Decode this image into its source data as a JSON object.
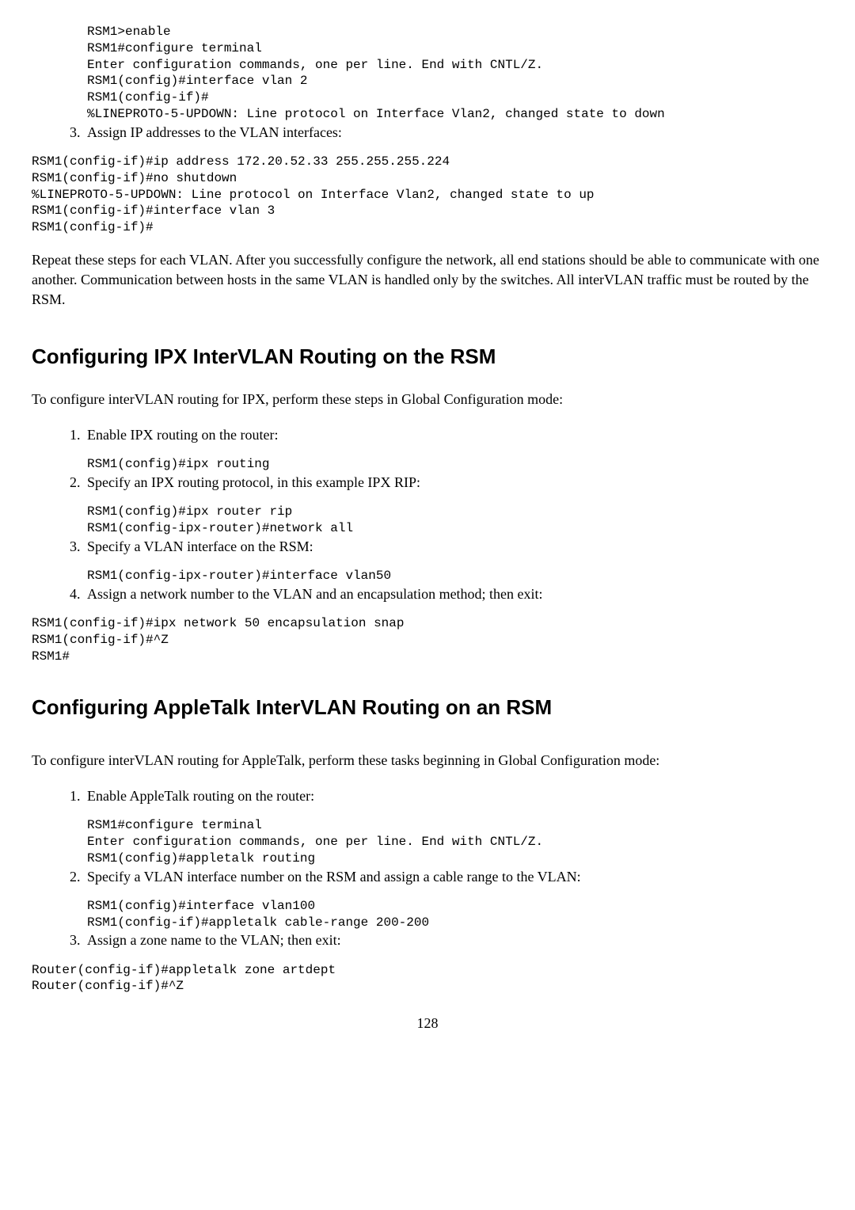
{
  "section_continued": {
    "code1": "RSM1>enable\nRSM1#configure terminal\nEnter configuration commands, one per line. End with CNTL/Z.\nRSM1(config)#interface vlan 2\nRSM1(config-if)#\n%LINEPROTO-5-UPDOWN: Line protocol on Interface Vlan2, changed state to down",
    "step3_num": "3. ",
    "step3_text": "Assign IP addresses to the VLAN interfaces:",
    "code2": "RSM1(config-if)#ip address 172.20.52.33 255.255.255.224\nRSM1(config-if)#no shutdown\n%LINEPROTO-5-UPDOWN: Line protocol on Interface Vlan2, changed state to up\nRSM1(config-if)#interface vlan 3\nRSM1(config-if)#",
    "closing_para": "Repeat these steps for each VLAN. After you successfully configure the network, all end stations should be able to communicate with one another. Communication between hosts in the same VLAN is handled only by the switches. All interVLAN traffic must be routed by the RSM."
  },
  "ipx": {
    "heading": "Configuring IPX InterVLAN Routing on the RSM",
    "intro": "To configure interVLAN routing for IPX, perform these steps in Global Configuration mode:",
    "step1_num": "1. ",
    "step1_text": "Enable IPX routing on the router:",
    "code1": "RSM1(config)#ipx routing",
    "step2_num": "2. ",
    "step2_text": "Specify an IPX routing protocol, in this example IPX RIP:",
    "code2": "RSM1(config)#ipx router rip\nRSM1(config-ipx-router)#network all",
    "step3_num": "3. ",
    "step3_text": "Specify a VLAN interface on the RSM:",
    "code3": "RSM1(config-ipx-router)#interface vlan50",
    "step4_num": "4. ",
    "step4_text": "Assign a network number to the VLAN and an encapsulation method; then exit:",
    "code4": "RSM1(config-if)#ipx network 50 encapsulation snap\nRSM1(config-if)#^Z\nRSM1#"
  },
  "appletalk": {
    "heading": "Configuring AppleTalk InterVLAN Routing on an RSM",
    "intro": "To configure interVLAN routing for AppleTalk, perform these tasks beginning in Global Configuration mode:",
    "step1_num": "1. ",
    "step1_text": "Enable AppleTalk routing on the router:",
    "code1": "RSM1#configure terminal\nEnter configuration commands, one per line. End with CNTL/Z.\nRSM1(config)#appletalk routing",
    "step2_num": "2. ",
    "step2_text": "Specify a VLAN interface number on the RSM and assign a cable range to the VLAN:",
    "code2": "RSM1(config)#interface vlan100\nRSM1(config-if)#appletalk cable-range 200-200",
    "step3_num": "3. ",
    "step3_text": "Assign a zone name to the VLAN; then exit:",
    "code3": "Router(config-if)#appletalk zone artdept\nRouter(config-if)#^Z"
  },
  "page_number": "128"
}
